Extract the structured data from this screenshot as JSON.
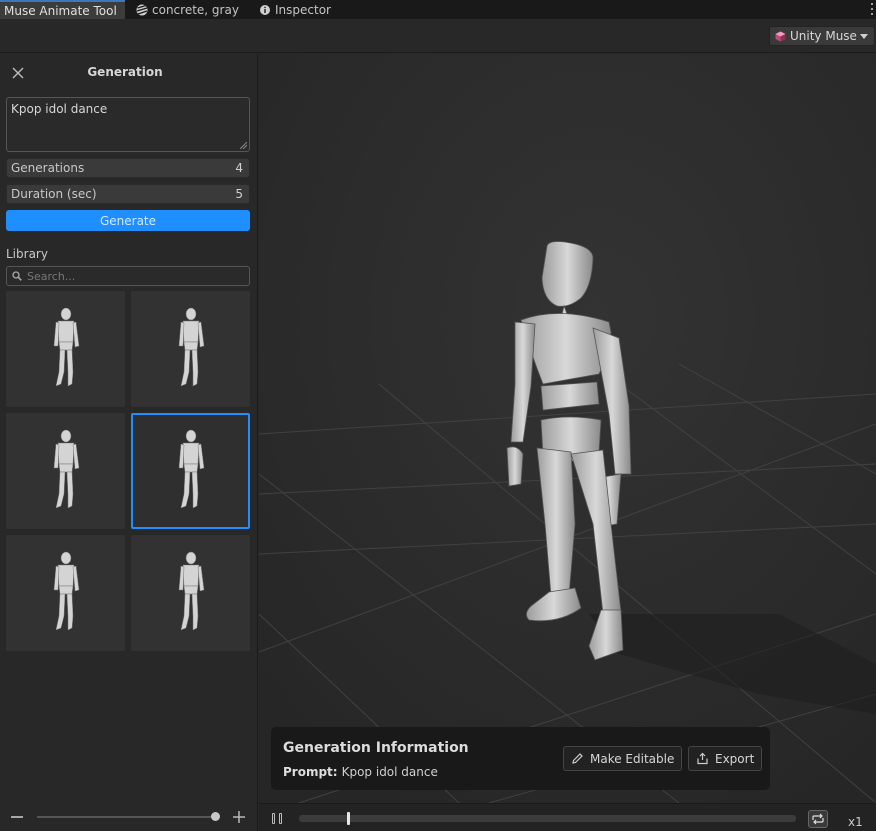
{
  "tabs": [
    {
      "label": "Muse Animate Tool",
      "active": true,
      "icon": null
    },
    {
      "label": "concrete, gray",
      "active": false,
      "icon": "material-icon"
    },
    {
      "label": "Inspector",
      "active": false,
      "icon": "info-icon"
    }
  ],
  "toolbar": {
    "muse_label": "Unity Muse",
    "muse_icon": "muse-cube-icon"
  },
  "panel": {
    "title": "Generation",
    "prompt_value": "Kpop idol dance",
    "fields": [
      {
        "label": "Generations",
        "value": "4"
      },
      {
        "label": "Duration (sec)",
        "value": "5"
      }
    ],
    "generate_label": "Generate",
    "library_label": "Library",
    "search_placeholder": "Search...",
    "thumbnails": [
      {
        "selected": false
      },
      {
        "selected": false
      },
      {
        "selected": false
      },
      {
        "selected": true
      },
      {
        "selected": false
      },
      {
        "selected": false
      }
    ],
    "zoom_level": 1.0
  },
  "info": {
    "title": "Generation Information",
    "prompt_label": "Prompt:",
    "prompt_value": "Kpop idol dance",
    "make_editable_label": "Make Editable",
    "export_label": "Export"
  },
  "timeline": {
    "progress": 0.097,
    "speed_label": "x1",
    "loop_enabled": true
  },
  "colors": {
    "accent": "#1f8eff",
    "bg": "#282828",
    "viewport": "#2d2d2d"
  }
}
